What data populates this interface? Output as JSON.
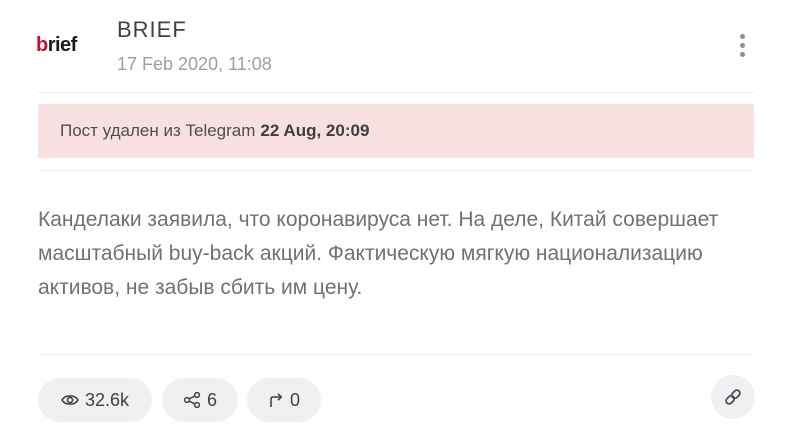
{
  "channel": {
    "logo_text_accent": "b",
    "logo_text_rest": "rief",
    "name": "BRIEF",
    "date": "17 Feb 2020, 11:08"
  },
  "banner": {
    "text": "Пост удален из Telegram",
    "date": "22 Aug, 20:09"
  },
  "post": {
    "text": "Канделаки заявила, что коронавируса нет. На деле, Китай совершает масштабный buy-back акций. Фактическую мягкую национализацию активов, не забыв сбить им цену."
  },
  "stats": {
    "views": "32.6k",
    "shares": "6",
    "forwards": "0"
  },
  "icons": {
    "menu": "kebab-menu-icon",
    "views": "eye-icon",
    "shares": "share-icon",
    "forwards": "forward-arrow-icon",
    "link": "link-icon"
  },
  "colors": {
    "banner_background": "#f9e0e0",
    "logo_accent": "#c8102e",
    "pill_background": "#eef0f2"
  }
}
